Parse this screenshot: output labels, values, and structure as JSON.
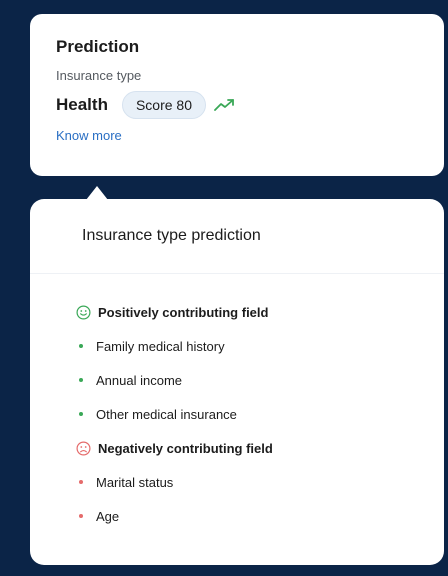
{
  "prediction": {
    "title": "Prediction",
    "subtitle": "Insurance type",
    "value": "Health",
    "score_label": "Score 80",
    "know_more": "Know more",
    "trend_icon": "trend-up-icon",
    "trend_color": "#3aa857"
  },
  "panel": {
    "title": "Insurance type prediction",
    "positive": {
      "heading": "Positively contributing field",
      "icon": "smile-icon",
      "color": "#3aa857",
      "items": [
        "Family medical history",
        "Annual income",
        "Other medical insurance"
      ]
    },
    "negative": {
      "heading": "Negatively contributing field",
      "icon": "frown-icon",
      "color": "#e56b6b",
      "items": [
        "Marital status",
        "Age"
      ]
    }
  },
  "colors": {
    "background": "#0b2447",
    "link": "#2a6fc4",
    "pill": "#e8f0f8"
  }
}
